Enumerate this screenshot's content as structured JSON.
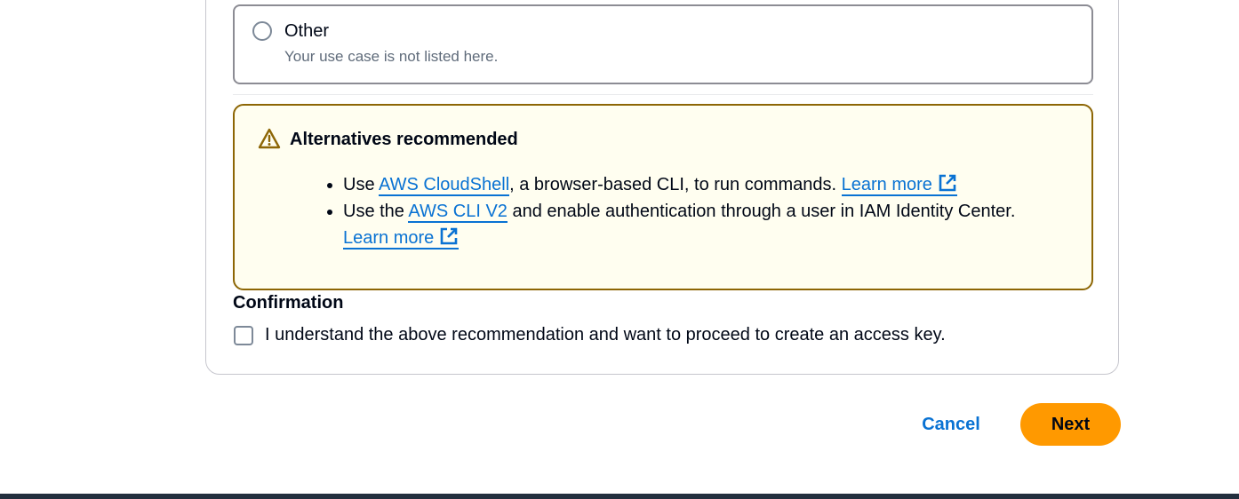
{
  "option": {
    "label": "Other",
    "description": "Your use case is not listed here."
  },
  "alert": {
    "title": "Alternatives recommended",
    "icon": "warning-icon",
    "items": [
      {
        "prefix": "Use ",
        "link": "AWS CloudShell",
        "suffix": ", a browser-based CLI, to run commands. ",
        "learn_more": "Learn more"
      },
      {
        "prefix": "Use the ",
        "link": "AWS CLI V2",
        "suffix": " and enable authentication through a user in IAM Identity Center. ",
        "learn_more": "Learn more"
      }
    ]
  },
  "confirmation": {
    "title": "Confirmation",
    "checkbox_label": "I understand the above recommendation and want to proceed to create an access key."
  },
  "actions": {
    "cancel": "Cancel",
    "next": "Next"
  },
  "colors": {
    "primary_button": "#ff9900",
    "link": "#0972d3",
    "warning_border": "#8d6605",
    "warning_background": "#fffef0"
  }
}
